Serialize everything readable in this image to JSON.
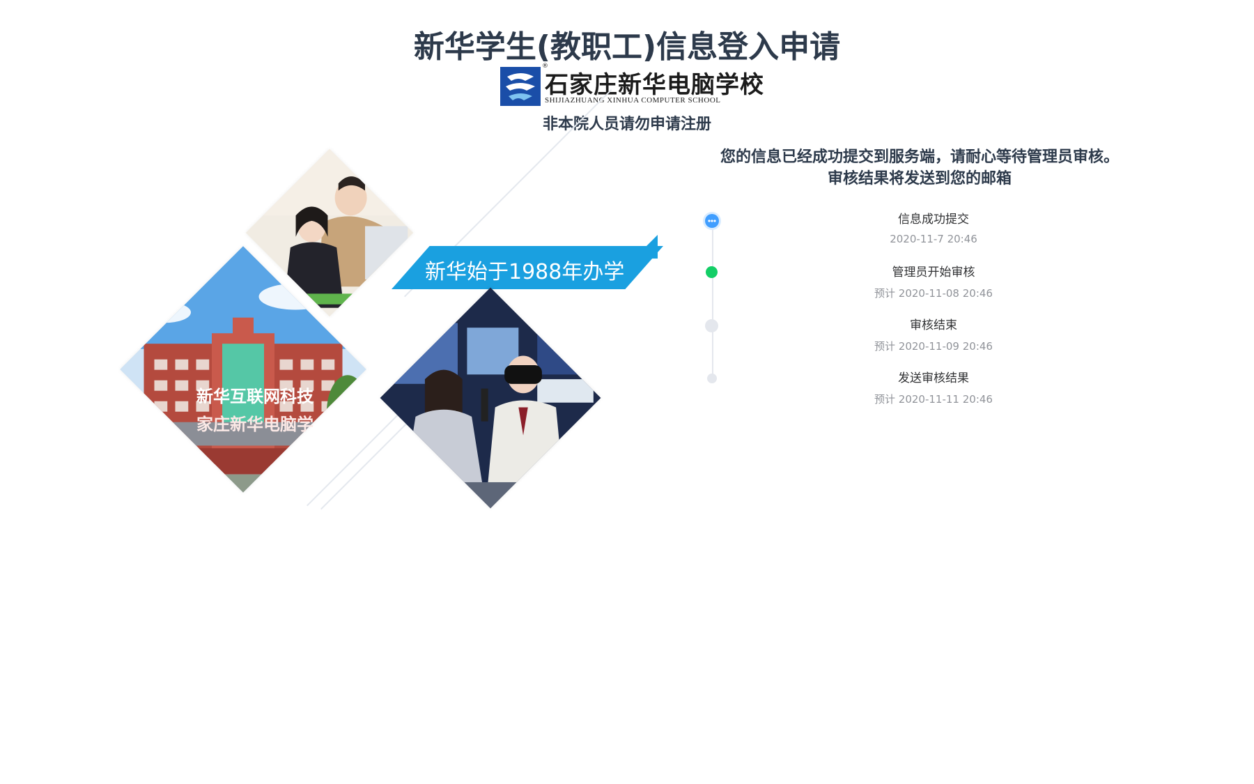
{
  "header": {
    "title": "新华学生(教职工)信息登入申请",
    "logo_cn": "石家庄新华电脑学校",
    "logo_en": "SHIJIAZHUANG XINHUA COMPUTER SCHOOL",
    "logo_reg": "®",
    "notice": "非本院人员请勿申请注册"
  },
  "illustration": {
    "banner": "新华始于1988年办学",
    "sign_top": "新华互联网科技",
    "sign_bottom": "家庄新华电脑学"
  },
  "status": {
    "line1": "您的信息已经成功提交到服务端，请耐心等待管理员审核。",
    "line2": "审核结果将发送到您的邮箱"
  },
  "timeline": [
    {
      "title": "信息成功提交",
      "time": "2020-11-7 20:46",
      "state": "active",
      "color": "#409eff"
    },
    {
      "title": "管理员开始审核",
      "time": "预计 2020-11-08 20:46",
      "state": "success",
      "color": "#13ce66"
    },
    {
      "title": "审核结束",
      "time": "预计 2020-11-09 20:46",
      "state": "pending",
      "color": "#e4e7ed"
    },
    {
      "title": "发送审核结果",
      "time": "预计 2020-11-11 20:46",
      "state": "pending",
      "color": "#e4e7ed"
    }
  ]
}
